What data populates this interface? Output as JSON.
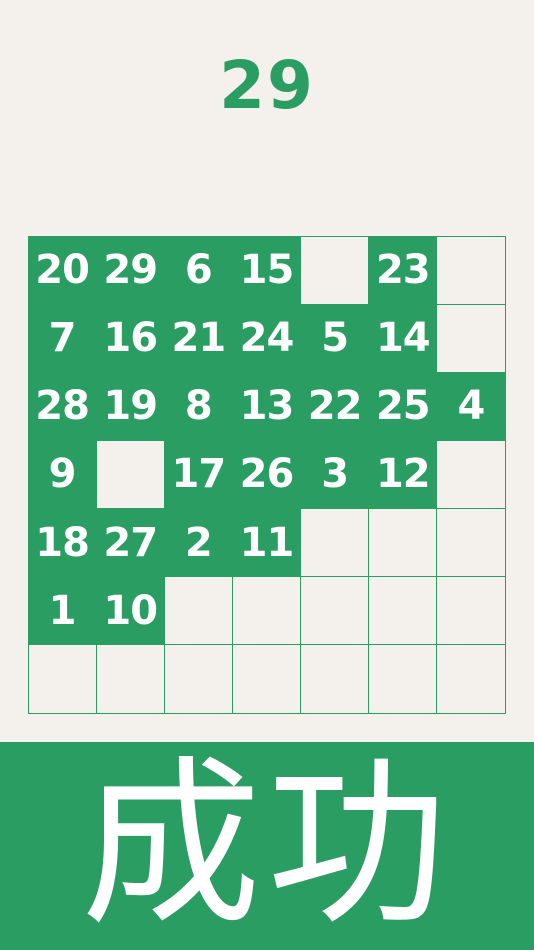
{
  "score": "29",
  "accent_color": "#2a9d62",
  "background_color": "#f4f0ec",
  "grid": {
    "rows": 7,
    "cols": 7,
    "cells": [
      [
        "20",
        "29",
        "6",
        "15",
        "",
        "23",
        ""
      ],
      [
        "7",
        "16",
        "21",
        "24",
        "5",
        "14",
        ""
      ],
      [
        "28",
        "19",
        "8",
        "13",
        "22",
        "25",
        "4"
      ],
      [
        "9",
        "",
        "17",
        "26",
        "3",
        "12",
        ""
      ],
      [
        "18",
        "27",
        "2",
        "11",
        "",
        "",
        ""
      ],
      [
        "1",
        "10",
        "",
        "",
        "",
        "",
        ""
      ],
      [
        "",
        "",
        "",
        "",
        "",
        "",
        ""
      ]
    ]
  },
  "success_label": "成功"
}
